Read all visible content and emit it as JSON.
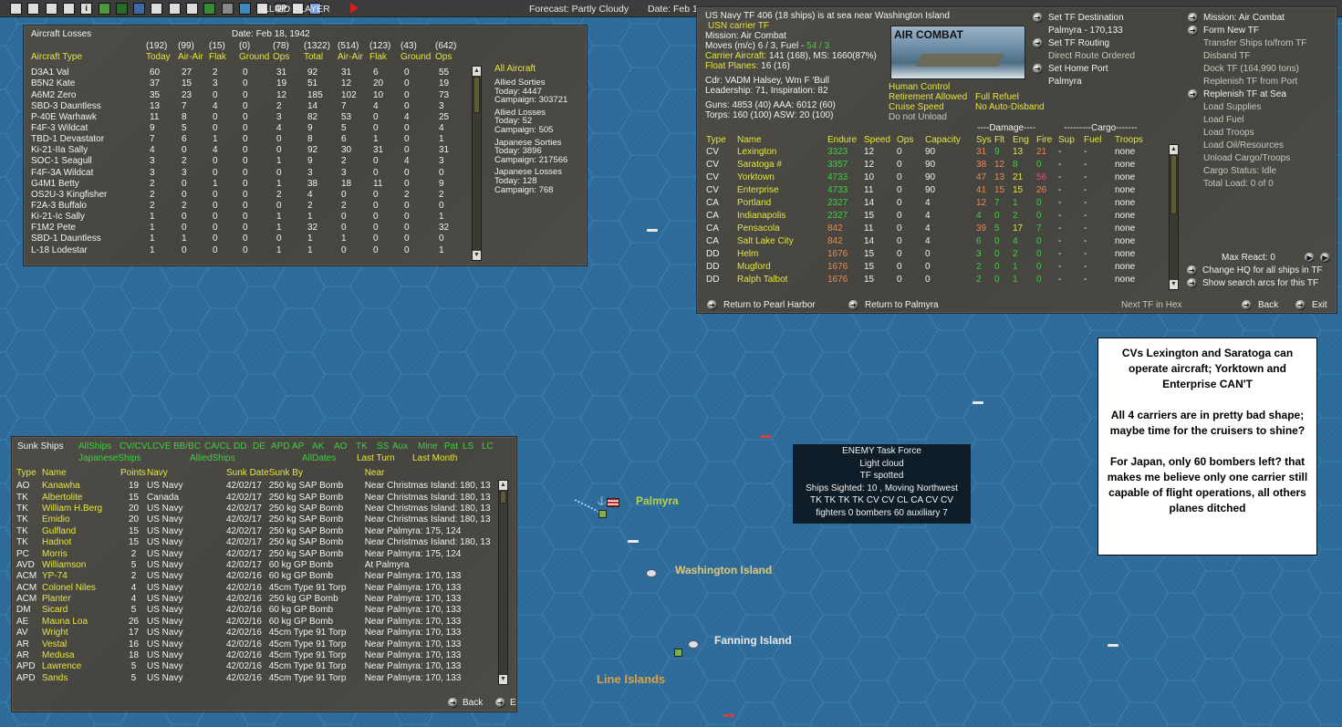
{
  "toolbar": {
    "icons": [
      "save-icon",
      "list-icon",
      "ship-list-icon",
      "group-list-icon",
      "info-icon",
      "star-icon",
      "aircraft-red-icon",
      "aircraft-blue-icon",
      "flag-icon",
      "base-icon",
      "airfield-icon",
      "chart-icon",
      "ground-units-icon",
      "globe-icon",
      "target-icon",
      "op-icon",
      "reports-icon",
      "weather-icon",
      "end-turn-icon"
    ],
    "op_label": "OP",
    "info_label": "i",
    "player": "ALLIED PLAYER",
    "forecast": "Forecast: Partly Cloudy",
    "date": "Date: Feb 1"
  },
  "aircraft_losses": {
    "title": "Aircraft Losses",
    "date": "Date: Feb 18, 1942",
    "type_header": "Aircraft Type",
    "totals": [
      "(192)",
      "(99)",
      "(15)",
      "(0)",
      "(78)",
      "(1322)",
      "(514)",
      "(123)",
      "(43)",
      "(642)"
    ],
    "headers": [
      "Today",
      "Air-Air",
      "Flak",
      "Ground",
      "Ops",
      "Total",
      "Air-Air",
      "Flak",
      "Ground",
      "Ops"
    ],
    "rows": [
      [
        "D3A1 Val",
        "60",
        "27",
        "2",
        "0",
        "31",
        "92",
        "31",
        "6",
        "0",
        "55"
      ],
      [
        "B5N2 Kate",
        "37",
        "15",
        "3",
        "0",
        "19",
        "51",
        "12",
        "20",
        "0",
        "19"
      ],
      [
        "A6M2 Zero",
        "35",
        "23",
        "0",
        "0",
        "12",
        "185",
        "102",
        "10",
        "0",
        "73"
      ],
      [
        "SBD-3 Dauntless",
        "13",
        "7",
        "4",
        "0",
        "2",
        "14",
        "7",
        "4",
        "0",
        "3"
      ],
      [
        "P-40E Warhawk",
        "11",
        "8",
        "0",
        "0",
        "3",
        "82",
        "53",
        "0",
        "4",
        "25"
      ],
      [
        "F4F-3 Wildcat",
        "9",
        "5",
        "0",
        "0",
        "4",
        "9",
        "5",
        "0",
        "0",
        "4"
      ],
      [
        "TBD-1 Devastator",
        "7",
        "6",
        "1",
        "0",
        "0",
        "8",
        "6",
        "1",
        "0",
        "1"
      ],
      [
        "Ki-21-IIa Sally",
        "4",
        "0",
        "4",
        "0",
        "0",
        "92",
        "30",
        "31",
        "0",
        "31"
      ],
      [
        "SOC-1 Seagull",
        "3",
        "2",
        "0",
        "0",
        "1",
        "9",
        "2",
        "0",
        "4",
        "3"
      ],
      [
        "F4F-3A Wildcat",
        "3",
        "3",
        "0",
        "0",
        "0",
        "3",
        "3",
        "0",
        "0",
        "0"
      ],
      [
        "G4M1 Betty",
        "2",
        "0",
        "1",
        "0",
        "1",
        "38",
        "18",
        "11",
        "0",
        "9"
      ],
      [
        "OS2U-3 Kingfisher",
        "2",
        "0",
        "0",
        "0",
        "2",
        "4",
        "0",
        "0",
        "2",
        "2"
      ],
      [
        "F2A-3 Buffalo",
        "2",
        "2",
        "0",
        "0",
        "0",
        "2",
        "2",
        "0",
        "0",
        "0"
      ],
      [
        "Ki-21-Ic Sally",
        "1",
        "0",
        "0",
        "0",
        "1",
        "1",
        "0",
        "0",
        "0",
        "1"
      ],
      [
        "F1M2 Pete",
        "1",
        "0",
        "0",
        "0",
        "1",
        "32",
        "0",
        "0",
        "0",
        "32"
      ],
      [
        "SBD-1 Dauntless",
        "1",
        "1",
        "0",
        "0",
        "0",
        "1",
        "1",
        "0",
        "0",
        "0"
      ],
      [
        "L-18 Lodestar",
        "1",
        "0",
        "0",
        "0",
        "1",
        "1",
        "0",
        "0",
        "0",
        "1"
      ]
    ],
    "summary": {
      "filter": "All Aircraft",
      "lines": [
        "Allied Sorties",
        "Today:   4447",
        "Campaign: 303721",
        "Allied Losses",
        "Today:   52",
        "Campaign: 505",
        "Japanese Sorties",
        "Today:   3896",
        "Campaign: 217566",
        "Japanese Losses",
        "Today:   128",
        "Campaign: 768"
      ]
    }
  },
  "tf": {
    "status": "US Navy TF 406 (18 ships) is at sea near Washington Island",
    "type": "USN carrier TF",
    "mission": "Mission: Air Combat",
    "moves": "Moves (m/c)  6 / 3, Fuel - ",
    "fuel": "54 / 3",
    "carrier_label": "Carrier Aircraft:",
    "carrier_value": " 141 (168), MS: 1660(87%)",
    "float_label": "Float Planes:",
    "float_value": " 16 (16)",
    "cdr": "Cdr: VADM Halsey, Wm F 'Bull",
    "leadership": "Leadership: 71, Inspiration: 82",
    "guns": "Guns: 4853 (40)    AAA: 6012 (60)",
    "torps": "Torps: 160 (100)   ASW: 20 (100)",
    "image_caption": "AIR COMBAT",
    "flags": [
      "Human Control",
      "Retirement Allowed",
      "Full Refuel",
      "Cruise Speed",
      "No Auto-Disband",
      "Do not Unload"
    ],
    "mid_actions": [
      {
        "label": "Set TF Destination",
        "sub": "Palmyra - 170,133"
      },
      {
        "label": "Set TF Routing",
        "sub": "Direct Route Ordered"
      },
      {
        "label": "Set Home Port",
        "sub": "Palmyra"
      }
    ],
    "right_actions": [
      {
        "label": "Mission: Air Combat",
        "active": true
      },
      {
        "label": "Form New TF",
        "active": true
      },
      {
        "label": "Transfer Ships to/from TF",
        "active": false
      },
      {
        "label": "Disband TF",
        "active": false
      },
      {
        "label": "Dock TF (164,990 tons)",
        "active": false
      },
      {
        "label": "Replenish TF from Port",
        "active": false
      },
      {
        "label": "Replenish TF at Sea",
        "active": true
      },
      {
        "label": "Load Supplies",
        "active": false
      },
      {
        "label": "Load Fuel",
        "active": false
      },
      {
        "label": "Load Troops",
        "active": false
      },
      {
        "label": "Load Oil/Resources",
        "active": false
      },
      {
        "label": "Unload Cargo/Troops",
        "active": false
      },
      {
        "label": "Cargo Status: Idle",
        "active": false
      },
      {
        "label": "Total Load: 0 of 0",
        "active": false
      }
    ],
    "damage_group": "----Damage----",
    "cargo_group": "---------Cargo-------",
    "headers": [
      "Type",
      "Name",
      "Endure",
      "Speed",
      "Ops",
      "Capacity",
      "Sys",
      "Flt",
      "Eng",
      "Fire",
      "Sup",
      "Fuel",
      "Troops"
    ],
    "ships": [
      {
        "type": "CV",
        "name": "Lexington",
        "endure": "3323",
        "ec": "g",
        "speed": "12",
        "ops": "0",
        "cap": "90",
        "sys": "31",
        "sc": "o",
        "flt": "9",
        "fc": "g",
        "eng": "13",
        "gc": "y",
        "fire": "21",
        "rc": "o"
      },
      {
        "type": "CV",
        "name": "Saratoga #",
        "endure": "3357",
        "ec": "g",
        "speed": "12",
        "ops": "0",
        "cap": "90",
        "sys": "38",
        "sc": "o",
        "flt": "12",
        "fc": "o",
        "eng": "8",
        "gc": "g",
        "fire": "0",
        "rc": "g"
      },
      {
        "type": "CV",
        "name": "Yorktown",
        "endure": "4733",
        "ec": "g",
        "speed": "10",
        "ops": "0",
        "cap": "90",
        "sys": "47",
        "sc": "o",
        "flt": "13",
        "fc": "o",
        "eng": "21",
        "gc": "y",
        "fire": "56",
        "rc": "r"
      },
      {
        "type": "CV",
        "name": "Enterprise",
        "endure": "4733",
        "ec": "g",
        "speed": "11",
        "ops": "0",
        "cap": "90",
        "sys": "41",
        "sc": "o",
        "flt": "15",
        "fc": "o",
        "eng": "15",
        "gc": "y",
        "fire": "26",
        "rc": "o"
      },
      {
        "type": "CA",
        "name": "Portland",
        "endure": "2327",
        "ec": "g",
        "speed": "14",
        "ops": "0",
        "cap": "4",
        "sys": "12",
        "sc": "o",
        "flt": "7",
        "fc": "g",
        "eng": "1",
        "gc": "g",
        "fire": "0",
        "rc": "g"
      },
      {
        "type": "CA",
        "name": "Indianapolis",
        "endure": "2327",
        "ec": "g",
        "speed": "15",
        "ops": "0",
        "cap": "4",
        "sys": "4",
        "sc": "g",
        "flt": "0",
        "fc": "g",
        "eng": "2",
        "gc": "g",
        "fire": "0",
        "rc": "g"
      },
      {
        "type": "CA",
        "name": "Pensacola",
        "endure": "842",
        "ec": "o",
        "speed": "11",
        "ops": "0",
        "cap": "4",
        "sys": "39",
        "sc": "o",
        "flt": "5",
        "fc": "g",
        "eng": "17",
        "gc": "y",
        "fire": "7",
        "rc": "g"
      },
      {
        "type": "CA",
        "name": "Salt Lake City",
        "endure": "842",
        "ec": "o",
        "speed": "14",
        "ops": "0",
        "cap": "4",
        "sys": "6",
        "sc": "g",
        "flt": "0",
        "fc": "g",
        "eng": "4",
        "gc": "g",
        "fire": "0",
        "rc": "g"
      },
      {
        "type": "DD",
        "name": "Helm",
        "endure": "1676",
        "ec": "o",
        "speed": "15",
        "ops": "0",
        "cap": "0",
        "sys": "3",
        "sc": "g",
        "flt": "0",
        "fc": "g",
        "eng": "2",
        "gc": "g",
        "fire": "0",
        "rc": "g"
      },
      {
        "type": "DD",
        "name": "Mugford",
        "endure": "1676",
        "ec": "o",
        "speed": "15",
        "ops": "0",
        "cap": "0",
        "sys": "2",
        "sc": "g",
        "flt": "0",
        "fc": "g",
        "eng": "1",
        "gc": "g",
        "fire": "0",
        "rc": "g"
      },
      {
        "type": "DD",
        "name": "Ralph Talbot",
        "endure": "1676",
        "ec": "o",
        "speed": "15",
        "ops": "0",
        "cap": "0",
        "sys": "2",
        "sc": "g",
        "flt": "0",
        "fc": "g",
        "eng": "1",
        "gc": "g",
        "fire": "0",
        "rc": "g"
      }
    ],
    "cargo_dash": "-",
    "troops_none": "none",
    "max_react": "Max React:  0",
    "change_hq": "Change HQ for all ships in TF",
    "show_arcs": "Show search arcs for this TF",
    "return_pearl": "Return to Pearl Harbor",
    "return_palmyra": "Return to Palmyra",
    "next_tf": "Next TF in Hex",
    "back": "Back",
    "exit": "Exit"
  },
  "note": {
    "paragraphs": [
      "CVs Lexington and Saratoga can operate aircraft; Yorktown and Enterprise CAN'T",
      "All 4 carriers are in pretty bad shape; maybe time for the cruisers to shine?",
      "For Japan, only 60 bombers left? that makes me believe only one carrier still capable of flight operations, all others planes ditched"
    ]
  },
  "enemy_tf": {
    "lines": [
      "ENEMY Task Force",
      "Light cloud",
      "TF spotted",
      "Ships Sighted: 10 , Moving Northwest",
      "TK TK TK TK CV CV CL CA CV CV",
      "fighters 0   bombers 60   auxiliary 7"
    ]
  },
  "map": {
    "labels": {
      "palmyra": "Palmyra",
      "washington": "Washington Island",
      "fanning": "Fanning Island",
      "line_islands": "Line Islands"
    }
  },
  "sunk": {
    "title": "Sunk Ships",
    "filters": [
      "AllShips",
      "CV/CVL",
      "CVE",
      "BB/BC",
      "CA/CL",
      "DD",
      "DE",
      "APD",
      "AP",
      "AK",
      "AO",
      "TK",
      "SS",
      "Aux",
      "Mine",
      "Pat",
      "LS",
      "LC"
    ],
    "side_filters": [
      "JapaneseShips",
      "AlliedShips"
    ],
    "date_filters": [
      "AllDates",
      "Last Turn",
      "Last Month"
    ],
    "headers": [
      "Type",
      "Name",
      "Points",
      "Navy",
      "Sunk Date",
      "Sunk By",
      "Near"
    ],
    "rows": [
      [
        "AO",
        "Kanawha",
        "19",
        "US Navy",
        "42/02/17",
        "250 kg SAP Bomb",
        "Near Christmas Island: 180, 13"
      ],
      [
        "TK",
        "Albertolite",
        "15",
        "Canada",
        "42/02/17",
        "250 kg SAP Bomb",
        "Near Christmas Island: 180, 13"
      ],
      [
        "TK",
        "William H.Berg",
        "20",
        "US Navy",
        "42/02/17",
        "250 kg SAP Bomb",
        "Near Christmas Island: 180, 13"
      ],
      [
        "TK",
        "Emidio",
        "20",
        "US Navy",
        "42/02/17",
        "250 kg SAP Bomb",
        "Near Christmas Island: 180, 13"
      ],
      [
        "TK",
        "Gulfland",
        "15",
        "US Navy",
        "42/02/17",
        "250 kg SAP Bomb",
        "Near Palmyra: 175, 124"
      ],
      [
        "TK",
        "Hadnot",
        "15",
        "US Navy",
        "42/02/17",
        "250 kg SAP Bomb",
        "Near Christmas Island: 180, 13"
      ],
      [
        "PC",
        "Morris",
        "2",
        "US Navy",
        "42/02/17",
        "250 kg SAP Bomb",
        "Near Palmyra: 175, 124"
      ],
      [
        "AVD",
        "Williamson",
        "5",
        "US Navy",
        "42/02/17",
        "60 kg GP Bomb",
        "At Palmyra"
      ],
      [
        "ACM",
        "YP-74",
        "2",
        "US Navy",
        "42/02/16",
        "60 kg GP Bomb",
        "Near Palmyra: 170, 133"
      ],
      [
        "ACM",
        "Colonel Niles",
        "4",
        "US Navy",
        "42/02/16",
        "45cm Type 91 Torp",
        "Near Palmyra: 170, 133"
      ],
      [
        "ACM",
        "Planter",
        "4",
        "US Navy",
        "42/02/16",
        "250 kg GP Bomb",
        "Near Palmyra: 170, 133"
      ],
      [
        "DM",
        "Sicard",
        "5",
        "US Navy",
        "42/02/16",
        "60 kg GP Bomb",
        "Near Palmyra: 170, 133"
      ],
      [
        "AE",
        "Mauna Loa",
        "26",
        "US Navy",
        "42/02/16",
        "60 kg GP Bomb",
        "Near Palmyra: 170, 133"
      ],
      [
        "AV",
        "Wright",
        "17",
        "US Navy",
        "42/02/16",
        "45cm Type 91 Torp",
        "Near Palmyra: 170, 133"
      ],
      [
        "AR",
        "Vestal",
        "16",
        "US Navy",
        "42/02/16",
        "45cm Type 91 Torp",
        "Near Palmyra: 170, 133"
      ],
      [
        "AR",
        "Medusa",
        "18",
        "US Navy",
        "42/02/16",
        "45cm Type 91 Torp",
        "Near Palmyra: 170, 133"
      ],
      [
        "APD",
        "Lawrence",
        "5",
        "US Navy",
        "42/02/16",
        "45cm Type 91 Torp",
        "Near Palmyra: 170, 133"
      ],
      [
        "APD",
        "Sands",
        "5",
        "US Navy",
        "42/02/16",
        "45cm Type 91 Torp",
        "Near Palmyra: 170, 133"
      ]
    ],
    "back": "Back",
    "exit": "E"
  },
  "colors": {
    "sea": "#2f6d9c",
    "panel": "#4a4943",
    "yellow": "#e6e63a",
    "green": "#3fcf3f",
    "orange": "#e88a55",
    "red": "#d85575"
  }
}
